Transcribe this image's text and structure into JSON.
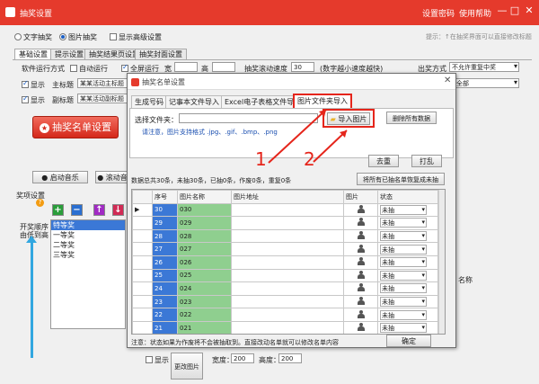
{
  "window": {
    "title": "抽奖设置",
    "links": [
      "设置密码",
      "使用帮助"
    ],
    "controls": [
      "—",
      "□",
      "✕"
    ]
  },
  "mode_bar": {
    "options": [
      "文字抽奖",
      "图片抽奖",
      "显示高级设置"
    ],
    "selected": 1,
    "tip": "提示：↑在抽奖界面可以直接修改标题"
  },
  "main_tabs": [
    "基础设置",
    "提示设置",
    "抽奖结果页设置",
    "抽奖封面设置"
  ],
  "settings": {
    "run_mode_label": "软件运行方式",
    "auto_run": "自动运行",
    "fullscreen": "全屏运行",
    "width_label": "宽",
    "height_label": "高",
    "speed_label": "抽奖滚动速度",
    "speed_value": "30",
    "speed_hint": "(数字越小速度越快)",
    "out_mode_label": "出奖方式",
    "out_mode_value": "不允许重复中奖",
    "show_label": "显示",
    "main_title_label": "主标题",
    "main_title_value": "某某活动主标题",
    "sub_title_label": "副标题",
    "sub_title_value": "某某活动副标题",
    "right_value": "全部"
  },
  "big_button": "抽奖名单设置",
  "bottom_buttons": [
    "启动音乐",
    "滚动音"
  ],
  "prize": {
    "section_label": "奖项设置",
    "tools": [
      "+",
      "−",
      "↑",
      "↓"
    ],
    "order_label_1": "开奖顺序",
    "order_label_2": "由低到高",
    "items": [
      "特等奖",
      "一等奖",
      "二等奖",
      "三等奖"
    ],
    "right_name_label": "名称"
  },
  "bottom_row": {
    "show": "显示",
    "photo": "更改图片",
    "width_label": "宽度：",
    "width_value": "200",
    "height_label": "高度：",
    "height_value": "200"
  },
  "dialog": {
    "title": "抽奖名单设置",
    "tabs": [
      "生成号码",
      "记事本文件导入",
      "Excel电子表格文件导入",
      "图片文件夹导入"
    ],
    "active_tab": 3,
    "folder_label": "选择文件夹：",
    "folder_value": "",
    "note": "请注意，图片支持格式 .jpg、.gif、.bmp、.png",
    "import_button": "导入图片",
    "delete_button": "删除所有数据",
    "dedupe_button": "去重",
    "shuffle_button": "打乱",
    "stats": "数据总共30条，未抽30条，已抽0条，作废0条，重复0条",
    "reset_button": "将所有已抽名单恢复成未抽",
    "columns": [
      "序号",
      "图片名称",
      "图片地址",
      "图片",
      "状态"
    ],
    "rows": [
      {
        "seq": "30",
        "name": "030",
        "status": "未抽"
      },
      {
        "seq": "29",
        "name": "029",
        "status": "未抽"
      },
      {
        "seq": "28",
        "name": "028",
        "status": "未抽"
      },
      {
        "seq": "27",
        "name": "027",
        "status": "未抽"
      },
      {
        "seq": "26",
        "name": "026",
        "status": "未抽"
      },
      {
        "seq": "25",
        "name": "025",
        "status": "未抽"
      },
      {
        "seq": "24",
        "name": "024",
        "status": "未抽"
      },
      {
        "seq": "23",
        "name": "023",
        "status": "未抽"
      },
      {
        "seq": "22",
        "name": "022",
        "status": "未抽"
      },
      {
        "seq": "21",
        "name": "021",
        "status": "未抽"
      }
    ],
    "footer_note": "注意：状态如果为作废将不会被抽取到。直接改动名单就可以修改名单内容",
    "ok_button": "确定"
  },
  "annotations": [
    "1",
    "2"
  ],
  "colors": {
    "title_red": "#e53a2c",
    "highlight_red": "#e5251b",
    "seq_blue": "#3b78d6",
    "name_green": "#8fcf8f"
  }
}
